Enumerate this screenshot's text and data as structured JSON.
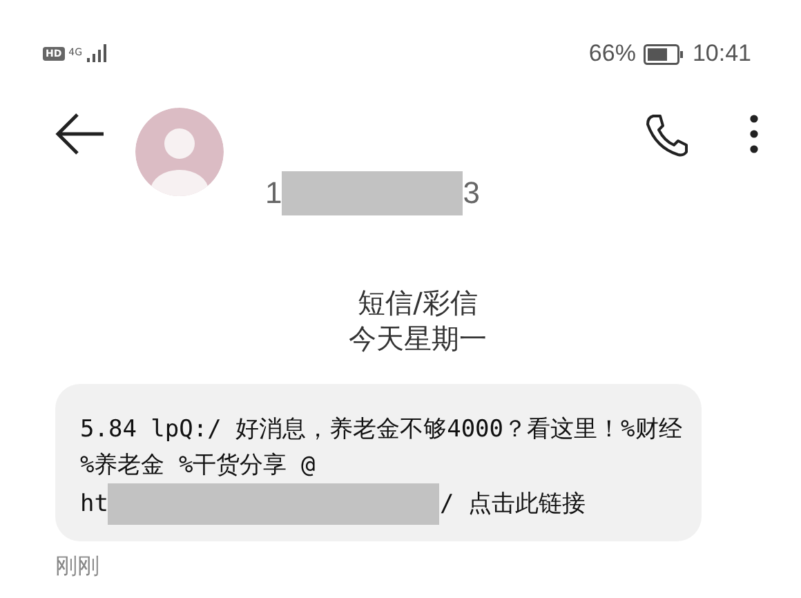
{
  "status_bar": {
    "hd_badge": "HD",
    "network": "4G",
    "battery_percent": "66%",
    "time": "10:41"
  },
  "header": {
    "number_start": "1",
    "number_end": "3",
    "number_redacted": true
  },
  "thread_info": {
    "channel": "短信/彩信",
    "date": "今天星期一"
  },
  "messages": [
    {
      "text": "5.84 lpQ:/ 好消息，养老金不够4000？看这里！%财经 %养老金 %干货分享 @",
      "link_start": "ht",
      "link_end": "/ 点击此链接",
      "link_redacted": true,
      "time": "刚刚"
    }
  ]
}
